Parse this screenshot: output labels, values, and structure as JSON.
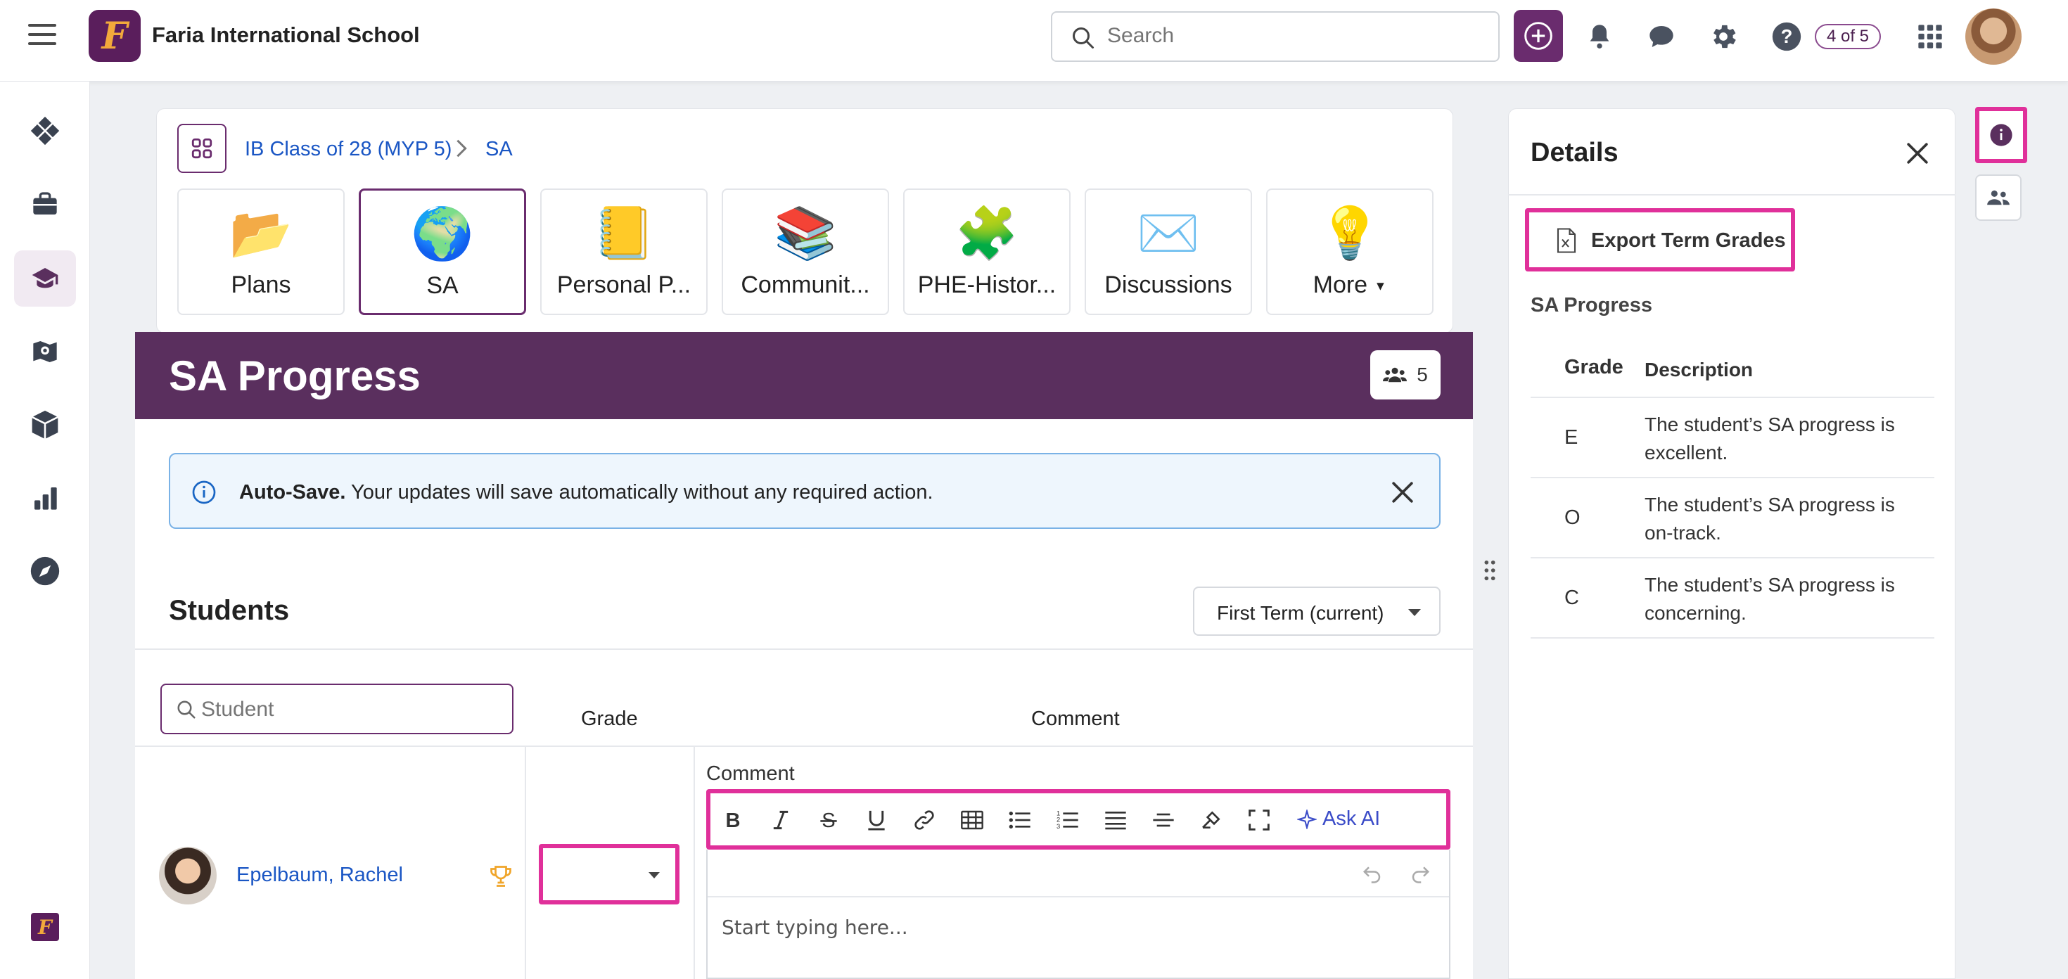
{
  "header": {
    "school_name": "Faria International School",
    "logo_letter": "F",
    "search_placeholder": "Search",
    "pagination_badge": "4 of 5"
  },
  "breadcrumb": {
    "items": [
      "IB Class of 28 (MYP 5)",
      "SA"
    ]
  },
  "tiles": [
    {
      "label": "Plans",
      "icon": "folder-icon",
      "emoji": "📂"
    },
    {
      "label": "SA",
      "icon": "globe-hands-icon",
      "emoji": "🌍"
    },
    {
      "label": "Personal P...",
      "icon": "notebook-icon",
      "emoji": "📒"
    },
    {
      "label": "Communit...",
      "icon": "books-icon",
      "emoji": "📚"
    },
    {
      "label": "PHE-Histor...",
      "icon": "puzzle-icon",
      "emoji": "🧩"
    },
    {
      "label": "Discussions",
      "icon": "envelope-icon",
      "emoji": "✉️"
    },
    {
      "label": "More",
      "icon": "lightbulb-icon",
      "emoji": "💡"
    }
  ],
  "page": {
    "title": "SA Progress",
    "member_count": "5"
  },
  "autosave": {
    "title": "Auto-Save.",
    "message": "Your updates will save automatically without any required action."
  },
  "students": {
    "title": "Students",
    "term": "First Term (current)",
    "search_placeholder": "Student",
    "col_grade": "Grade",
    "col_comment": "Comment",
    "rows": [
      {
        "name": "Epelbaum, Rachel",
        "grade": "",
        "comment_label": "Comment",
        "comment_placeholder": "Start typing here..."
      }
    ]
  },
  "editor": {
    "ask_ai_label": "Ask AI"
  },
  "details": {
    "title": "Details",
    "export_label": "Export Term Grades",
    "section_label": "SA Progress",
    "table_headers": {
      "grade": "Grade",
      "description": "Description"
    },
    "grades": [
      {
        "grade": "E",
        "description": "The student’s SA progress is excellent."
      },
      {
        "grade": "O",
        "description": "The student’s SA progress is on-track."
      },
      {
        "grade": "C",
        "description": "The student’s SA progress is concerning."
      }
    ]
  },
  "colors": {
    "brand": "#5a2f5e",
    "highlight": "#e0309a",
    "link": "#1a56c4",
    "autosave_bg": "#eef6fd"
  }
}
